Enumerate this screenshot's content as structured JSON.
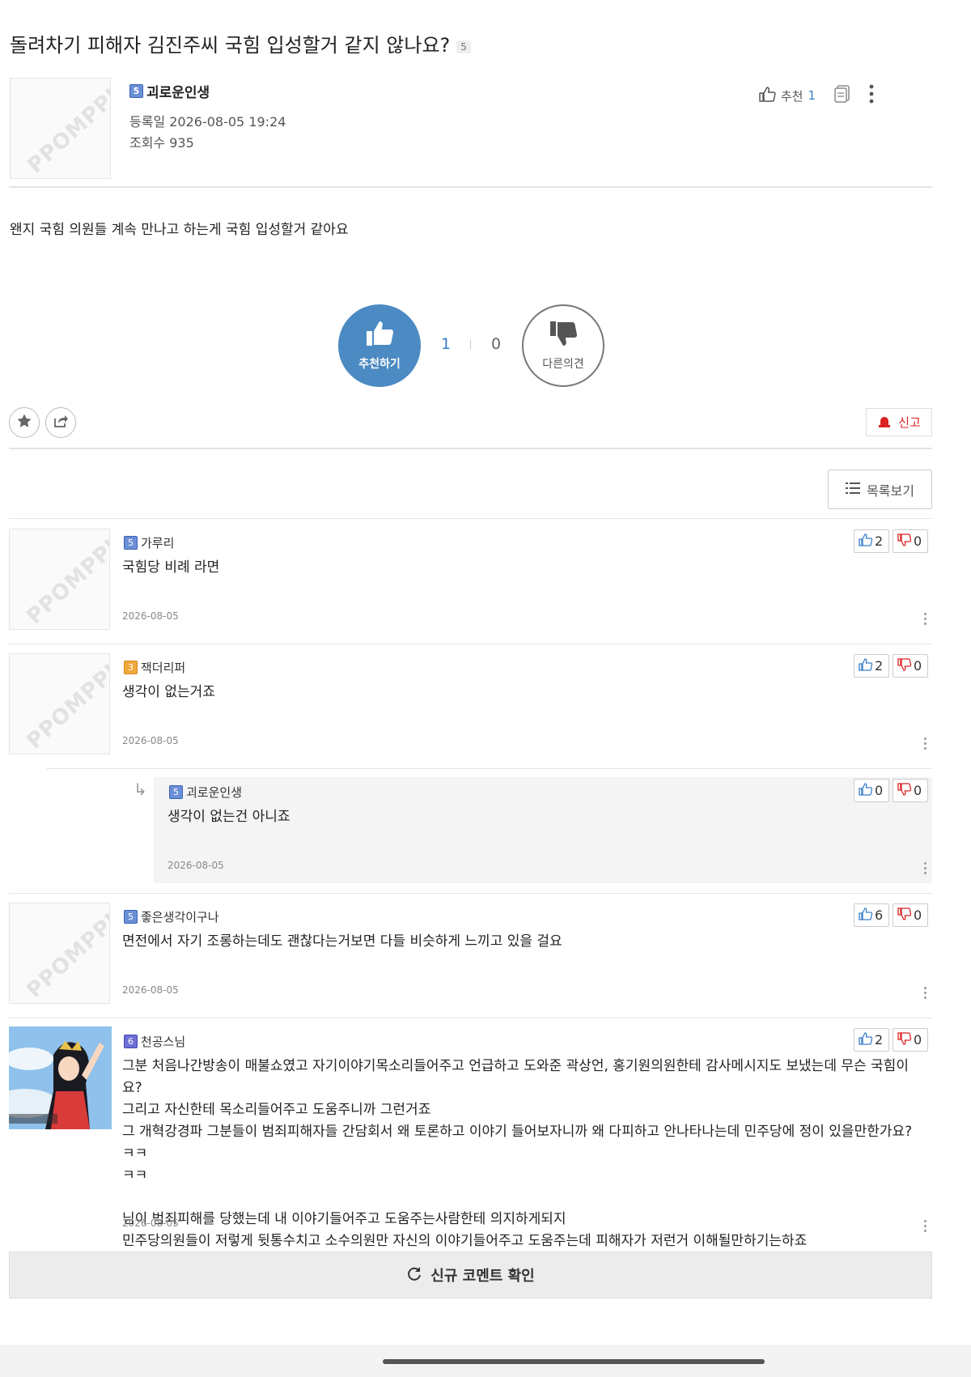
{
  "post": {
    "title": "돌려차기 피해자 김진주씨 국힘 입성할거 같지 않나요?",
    "comment_count": "5",
    "author": "괴로운인생",
    "author_level": "5",
    "date_label": "등록일 2026-08-05 19:24",
    "views_label": "조회수 935",
    "recommend_label": "추천",
    "recommend_count": "1",
    "avatar_watermark": "PPOMPPU",
    "body": "왠지 국힘 의원들 계속 만나고 하는게 국힘 입성할거 같아요"
  },
  "vote": {
    "up_label": "추천하기",
    "down_label": "다른의견",
    "up_count": "1",
    "down_count": "0"
  },
  "actions": {
    "report_label": "신고",
    "list_label": "목록보기"
  },
  "comments": [
    {
      "author": "가루리",
      "level": "5",
      "text": "국힘당 비례 라면",
      "date": "2026-08-05",
      "up": "2",
      "down": "0"
    },
    {
      "author": "잭더리퍼",
      "level": "3",
      "text": "생각이 없는거죠",
      "date": "2026-08-05",
      "up": "2",
      "down": "0"
    },
    {
      "author": "괴로운인생",
      "level": "5",
      "text": "생각이 없는건 아니죠",
      "date": "2026-08-05",
      "up": "0",
      "down": "0"
    },
    {
      "author": "좋은생각이구나",
      "level": "5",
      "text": "면전에서 자기 조롱하는데도 괜찮다는거보면 다들 비슷하게 느끼고 있을 걸요",
      "date": "2026-08-05",
      "up": "6",
      "down": "0"
    },
    {
      "author": "천공스님",
      "level": "6",
      "lines": [
        "그분 처음나간방송이 매불쇼였고 자기이야기목소리들어주고 언급하고 도와준 곽상언, 홍기원의원한테 감사메시지도 보냈는데 무슨 국힘이요?",
        "그리고 자신한테 목소리들어주고 도움주니까 그런거죠",
        "그 개혁강경파 그분들이 범죄피해자들 간담회서 왜 토론하고 이야기 들어보자니까 왜 다피하고 안나타나는데 민주당에 정이 있을만한가요?ㅋㅋ",
        "ㅋㅋ",
        "",
        "님이 범죄피해를 당했는데 내 이야기들어주고 도움주는사람한테 의지하게되지",
        "민주당의원들이 저렇게 뒷통수치고 소수의원만 자신의 이야기들어주고 도움주는데 피해자가 저런거 이해될만하기는하죠"
      ],
      "date": "2026-08-05",
      "up": "2",
      "down": "0"
    }
  ],
  "refresh_label": "신규 코멘트 확인",
  "colors": {
    "accent": "#4b8ac2",
    "report": "#d22222",
    "level_blue": "#6b8fd6",
    "level_orange": "#f0a93b",
    "level_indigo": "#6d6fd6"
  }
}
